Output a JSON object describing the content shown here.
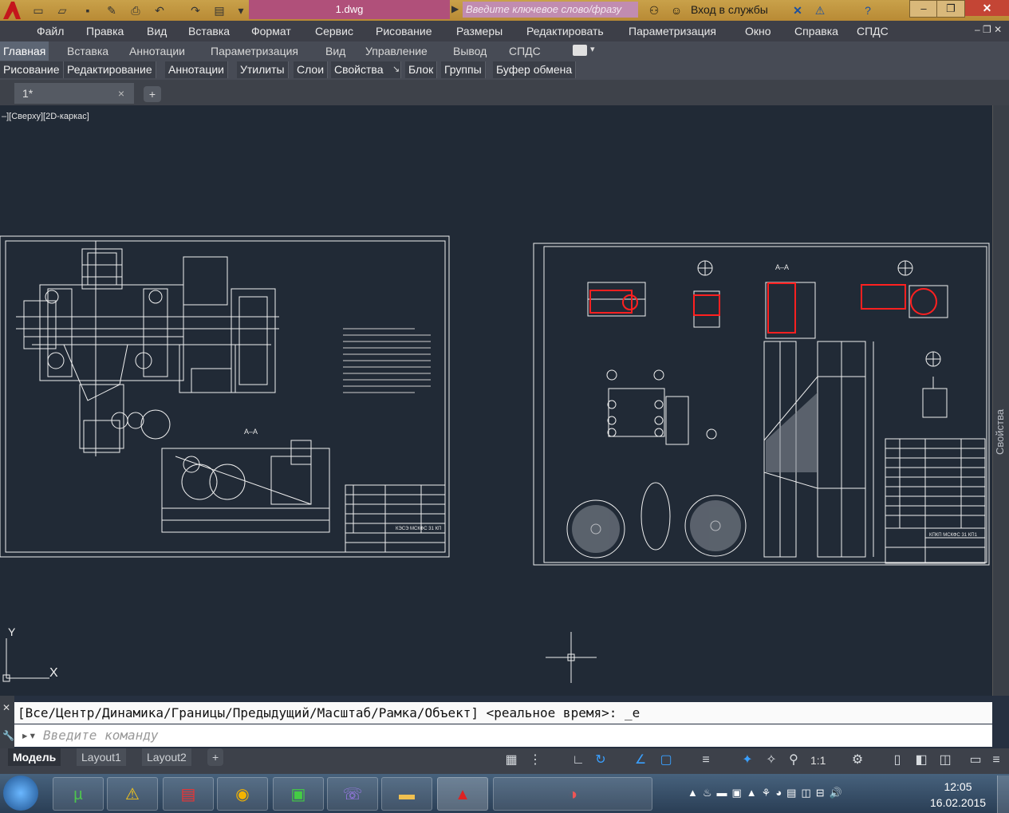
{
  "title_bar": {
    "doc_title": "1.dwg",
    "search_placeholder": "Введите ключевое слово/фразу",
    "login_label": "Вход в службы"
  },
  "menu": [
    "Файл",
    "Правка",
    "Вид",
    "Вставка",
    "Формат",
    "Сервис",
    "Рисование",
    "Размеры",
    "Редактировать",
    "Параметризация",
    "Окно",
    "Справка",
    "СПДС"
  ],
  "ribbon_tabs": [
    "Главная",
    "Вставка",
    "Аннотации",
    "Параметризация",
    "Вид",
    "Управление",
    "Вывод",
    "СПДС"
  ],
  "ribbon_panels": [
    "Рисование",
    "Редактирование",
    "Аннотации",
    "Утилиты",
    "Слои",
    "Свойства",
    "Блок",
    "Группы",
    "Буфер обмена"
  ],
  "doc_tab": {
    "label": "1*",
    "close": "×",
    "new": "+"
  },
  "viewport": {
    "label": "–][Сверху][2D-каркас]",
    "side_panel_label": "Свойства",
    "ucs_x": "X",
    "ucs_y": "Y",
    "sheet1": {
      "section_label": "А–А",
      "title_block": "КЭСЭ МСКФС 31 КП"
    },
    "sheet2": {
      "section_label": "А–А",
      "title_block": "КПКП МСКФС 31 КП1"
    }
  },
  "command": {
    "history": "[Все/Центр/Динамика/Границы/Предыдущий/Масштаб/Рамка/Объект] <реальное время>: _e",
    "placeholder": "Введите команду"
  },
  "layout_tabs": [
    "Модель",
    "Layout1",
    "Layout2"
  ],
  "status": {
    "scale": "1:1"
  },
  "taskbar": {
    "time": "12:05",
    "date": "16.02.2015"
  }
}
